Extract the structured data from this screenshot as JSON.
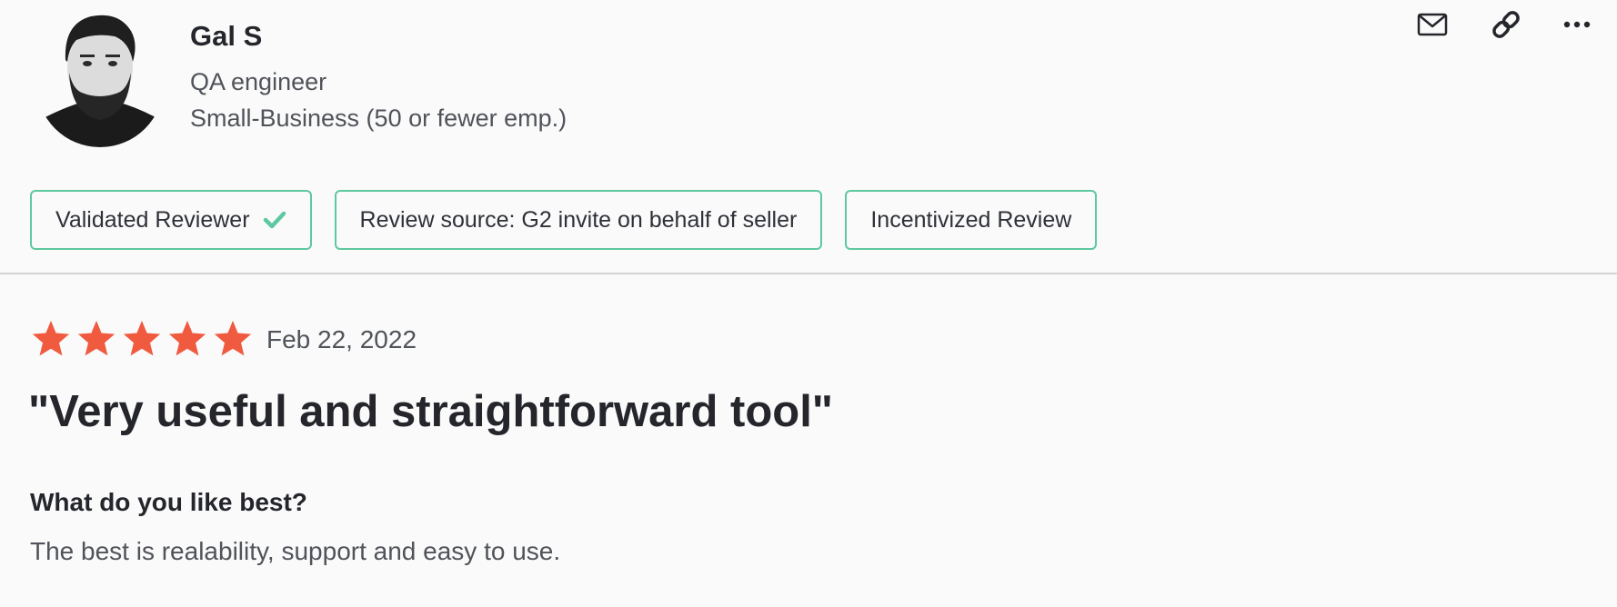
{
  "reviewer": {
    "name": "Gal S",
    "title": "QA engineer",
    "company_size": "Small-Business (50 or fewer emp.)",
    "avatar_icon": "person-avatar"
  },
  "actions": {
    "mail_icon": "envelope-icon",
    "link_icon": "link-icon",
    "more_icon": "more-horizontal-icon"
  },
  "badges": {
    "validated": "Validated Reviewer",
    "source": "Review source: G2 invite on behalf of seller",
    "incentivized": "Incentivized Review"
  },
  "review": {
    "rating": 5,
    "rating_max": 5,
    "date": "Feb 22, 2022",
    "title": "\"Very useful and straightforward tool\"",
    "question": "What do you like best?",
    "answer": "The best is realability, support and easy to use."
  },
  "colors": {
    "star": "#f05a3f",
    "badge_border": "#5ec8a0",
    "check": "#5ec8a0",
    "background": "#fafafa",
    "text_dark": "#25262c",
    "text_muted": "#505359"
  }
}
